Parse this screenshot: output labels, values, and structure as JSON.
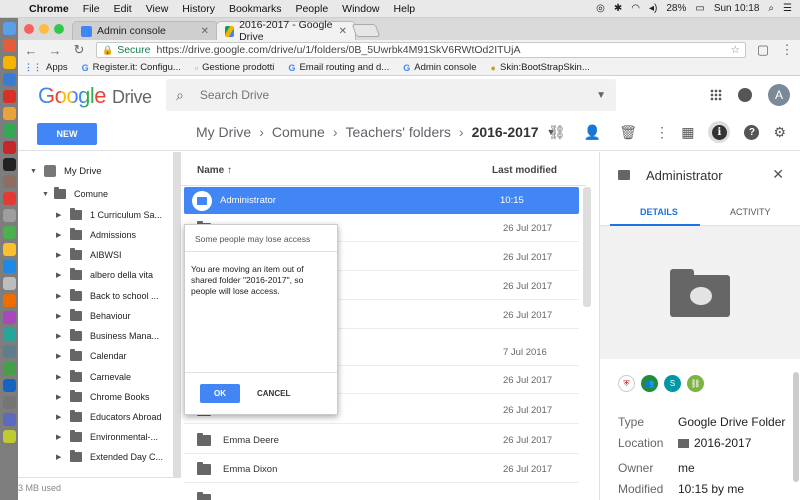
{
  "menubar": {
    "app": "Chrome",
    "items": [
      "File",
      "Edit",
      "View",
      "History",
      "Bookmarks",
      "People",
      "Window",
      "Help"
    ],
    "battery": "28%",
    "clock": "Sun 10:18"
  },
  "tabs": [
    {
      "label": "Admin console"
    },
    {
      "label": "2016-2017 - Google Drive"
    }
  ],
  "address": {
    "secure_label": "Secure",
    "url": "https://drive.google.com/drive/u/1/folders/0B_5Uwrbk4M91SkV6RWtOd2ITUjA"
  },
  "bookmarks": [
    {
      "label": "Apps"
    },
    {
      "label": "Register.it: Configu..."
    },
    {
      "label": "Gestione prodotti"
    },
    {
      "label": "Email routing and d..."
    },
    {
      "label": "Admin console"
    },
    {
      "label": "Skin:BootStrapSkin..."
    }
  ],
  "header": {
    "logo_text": "Google",
    "product": "Drive",
    "search_placeholder": "Search Drive",
    "avatar_letter": "A"
  },
  "toolbar": {
    "new_label": "NEW",
    "breadcrumb": [
      "My Drive",
      "Comune",
      "Teachers' folders",
      "2016-2017"
    ]
  },
  "sidebar": {
    "root": "My Drive",
    "parent": "Comune",
    "children": [
      "1 Curriculum Sa...",
      "Admissions",
      "AIBWSI",
      "albero della vita",
      "Back to school ...",
      "Behaviour",
      "Business Mana...",
      "Calendar",
      "Carnevale",
      "Chrome Books",
      "Educators Abroad",
      "Environmental-...",
      "Extended Day C..."
    ],
    "storage": "3 MB used"
  },
  "filelist": {
    "col_name": "Name",
    "col_modified": "Last modified",
    "rows": [
      {
        "name": "Administrator",
        "modified": "10:15"
      },
      {
        "name": "",
        "modified": "26 Jul 2017"
      },
      {
        "name": "",
        "modified": "26 Jul 2017"
      },
      {
        "name": "",
        "modified": "26 Jul 2017"
      },
      {
        "name": "",
        "modified": "26 Jul 2017"
      },
      {
        "name": "",
        "modified": "7 Jul 2016"
      },
      {
        "name": "",
        "modified": "26 Jul 2017"
      },
      {
        "name": "",
        "modified": "26 Jul 2017"
      },
      {
        "name": "Emma Deere",
        "modified": "26 Jul 2017"
      },
      {
        "name": "Emma Dixon",
        "modified": "26 Jul 2017"
      }
    ]
  },
  "dialog": {
    "title": "Some people may lose access",
    "body": "You are moving an item out of shared folder \"2016-2017\", so people will lose access.",
    "ok": "OK",
    "cancel": "CANCEL"
  },
  "details": {
    "title": "Administrator",
    "tab_details": "DETAILS",
    "tab_activity": "ACTIVITY",
    "avatar_s": "S",
    "props": [
      {
        "key": "Type",
        "value": "Google Drive Folder"
      },
      {
        "key": "Location",
        "value": "2016-2017"
      },
      {
        "key": "Owner",
        "value": "me"
      },
      {
        "key": "Modified",
        "value": "10:15 by me"
      }
    ]
  },
  "colors": {
    "accent": "#4285f4",
    "selected_row": "#4285f4",
    "avatar_green": "#1e8e3e",
    "avatar_teal": "#0097a7"
  }
}
